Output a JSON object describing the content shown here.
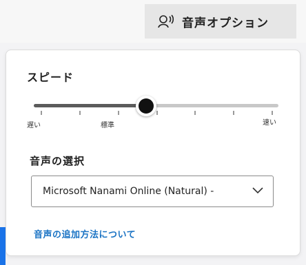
{
  "voice_options_button": {
    "label": "音声オプション",
    "icon": "voice-speaker-icon"
  },
  "speed": {
    "title": "スピード",
    "value": 0.46,
    "tick_count": 7,
    "labels": {
      "slow": "遅い",
      "normal": "標準",
      "fast": "速い"
    }
  },
  "voice": {
    "title": "音声の選択",
    "selected": "Microsoft Nanami Online (Natural) -",
    "dropdown_icon": "chevron-down-icon"
  },
  "add_voice_link": "音声の追加方法について",
  "colors": {
    "accent_blue": "#1a73c4",
    "slider_fill": "#5b5b5b",
    "slider_track": "#c8c8c8"
  }
}
